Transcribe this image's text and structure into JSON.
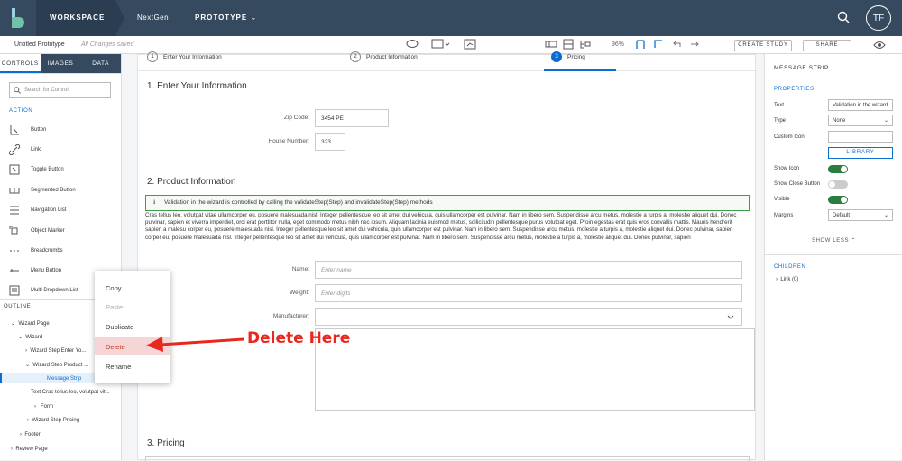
{
  "topbar": {
    "workspace": "WORKSPACE",
    "project": "NextGen",
    "prototype": "PROTOTYPE",
    "avatar": "TF"
  },
  "toolbar": {
    "title": "Untitled Prototype",
    "saved": "All Changes saved",
    "zoom": "96%",
    "create_study": "CREATE STUDY",
    "share": "SHARE"
  },
  "left": {
    "tabs": [
      "CONTROLS",
      "IMAGES",
      "DATA"
    ],
    "search_placeholder": "Search for Control",
    "section": "ACTION",
    "controls": [
      "Button",
      "Link",
      "Toggle Button",
      "Segmented Button",
      "Navigation List",
      "Object Marker",
      "Breadcrumbs",
      "Menu Button",
      "Multi Dropdown List"
    ],
    "outline": "OUTLINE",
    "tree": [
      "Wizard Page",
      "Wizard",
      "Wizard Step Enter Yo...",
      "Wizard Step Product ...",
      "Message Strip",
      "Text Cras tellus leo, volutpat vit...",
      "Form",
      "Wizard Step Pricing",
      "Footer",
      "Review Page"
    ]
  },
  "canvas": {
    "steps": [
      {
        "num": "1",
        "label": "Enter Your Information"
      },
      {
        "num": "2",
        "label": "Product Information"
      },
      {
        "num": "3",
        "label": "Pricing"
      }
    ],
    "sec1": "1. Enter Your Information",
    "zip_label": "Zip Code:",
    "zip_value": "3454 PE",
    "house_label": "House Number:",
    "house_value": "323",
    "sec2": "2. Product Information",
    "message": "Validation in the wizard is controlled by calling the validateStep(Step) and invalidateStep(Step) methods",
    "paragraph": "Cras tellus leo, volutpat vitae ullamcorper eu, posuere malesuada nisl. Integer pellentesque leo sit amet dui vehicula, quis ullamcorper est pulvinar. Nam in libero sem. Suspendisse arcu metus, molestie a turpis a, molestie aliquet dui. Donec pulvinar, sapien et viverra imperdiet, orci erat porttitor nulla, eget commodo metus nibh nec ipsum. Aliquam lacinia euismod metus, sollicitudin pellentesque purus volutpat eget. Proin egestas erat quis eros convallis mattis. Mauris hendrerit sapien a malesu corper eu, posuere malesuada nisl. Integer pellentesque leo sit amet dui vehicula, quis ullamcorper est pulvinar. Nam in libero sem. Suspendisse arcu metus, molestie a turpis a, molestie aliquet dui. Donec pulvinar, sapien corper eu, posuere malesuada nisl. Integer pellentesque leo sit amet dui vehicula, quis ullamcorper est pulvinar. Nam in libero sem. Suspendisse arcu metus, molestie a turpis a, molestie aliquet dui. Donec pulvinar, sapien",
    "name_label": "Name:",
    "name_ph": "Enter name",
    "weight_label": "Weight:",
    "weight_ph": "Enter digits",
    "manufacturer_label": "Manufacturer:",
    "sec3": "3. Pricing"
  },
  "right": {
    "title": "MESSAGE STRIP",
    "properties": "PROPERTIES",
    "text_label": "Text",
    "text_value": "Validation in the wizard",
    "type_label": "Type",
    "type_value": "None",
    "icon_label": "Custom Icon",
    "library": "LIBRARY",
    "showicon_label": "Show Icon",
    "close_label": "Show Close Button",
    "visible_label": "Visible",
    "margin_label": "Margins",
    "margin_value": "Default",
    "show_less": "SHOW LESS",
    "children": "CHILDREN",
    "child_link": "Link (0)"
  },
  "context_menu": [
    "Copy",
    "Paste",
    "Duplicate",
    "Delete",
    "Rename"
  ],
  "annotation": "Delete Here",
  "colors": {
    "header": "#354a5f",
    "accent": "#0a6ed1",
    "annotation": "#e8281e",
    "success": "#3f9d4a"
  }
}
